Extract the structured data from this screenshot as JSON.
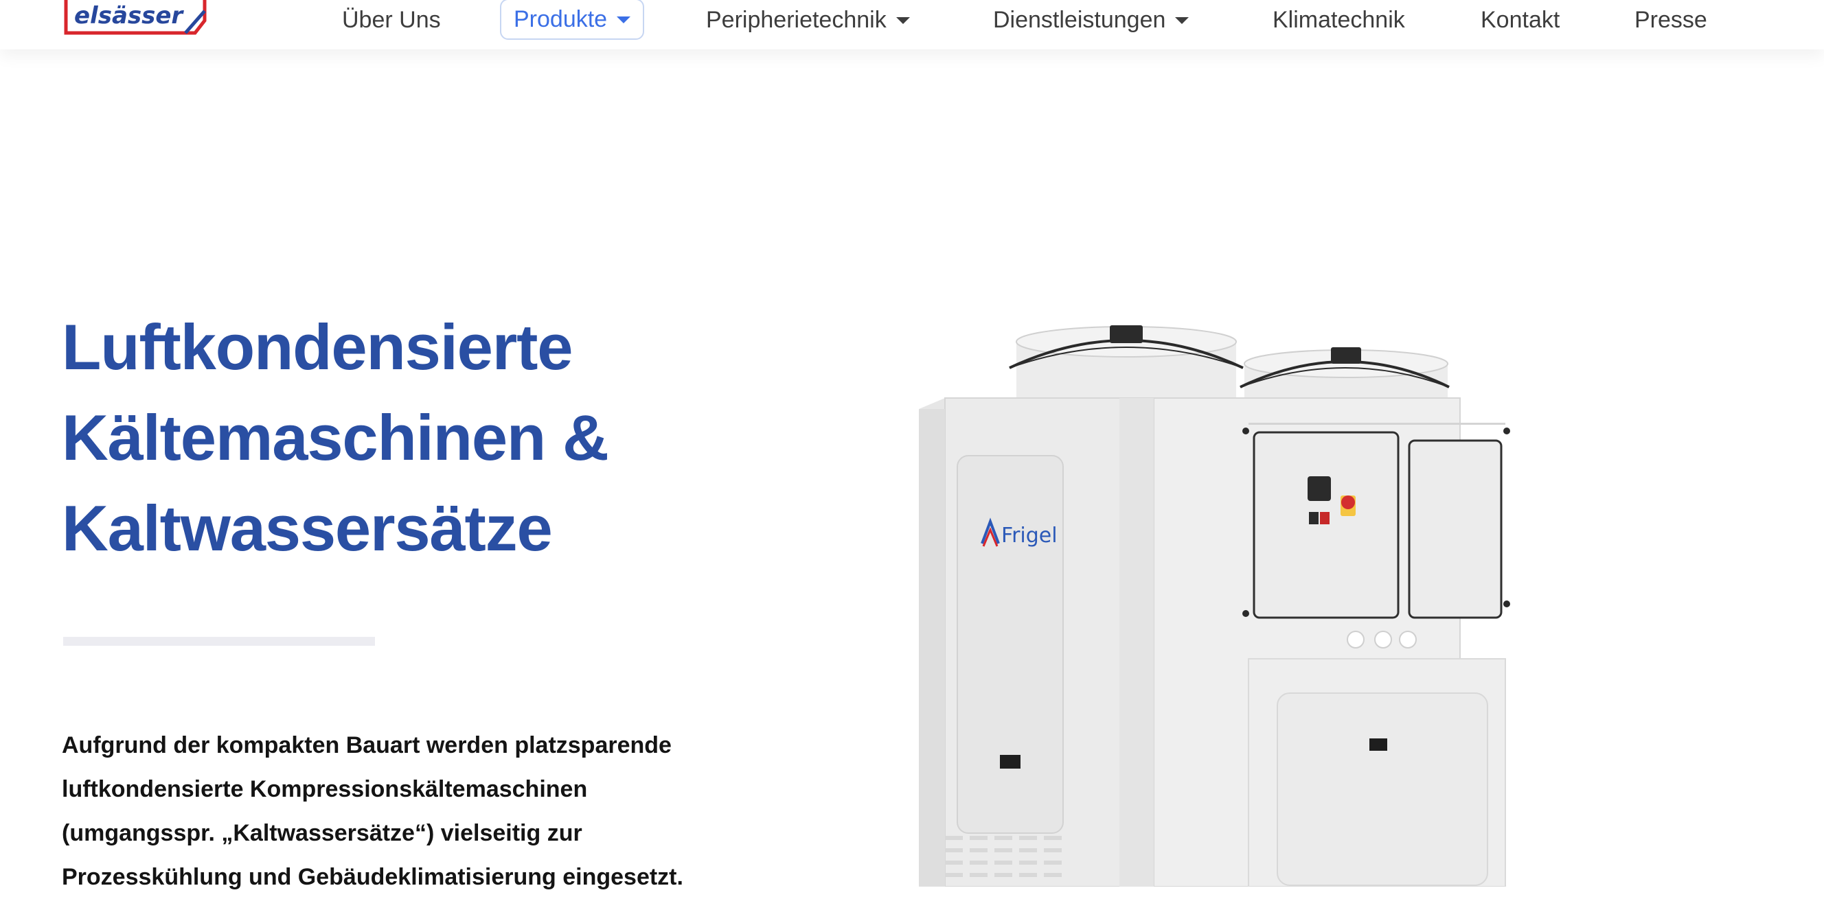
{
  "brand": {
    "logo_text": "elsässer"
  },
  "nav": {
    "items": [
      {
        "label": "Über Uns",
        "dropdown": false,
        "active": false
      },
      {
        "label": "Produkte",
        "dropdown": true,
        "active": true
      },
      {
        "label": "Peripherietechnik",
        "dropdown": true,
        "active": false
      },
      {
        "label": "Dienstleistungen",
        "dropdown": true,
        "active": false
      },
      {
        "label": "Klimatechnik",
        "dropdown": false,
        "active": false
      },
      {
        "label": "Kontakt",
        "dropdown": false,
        "active": false
      },
      {
        "label": "Presse",
        "dropdown": false,
        "active": false
      }
    ]
  },
  "hero": {
    "title_lines": [
      "Luftkondensierte",
      "Kältemaschinen &",
      "Kaltwassersätze"
    ],
    "paragraph_lines": [
      "Aufgrund der kompakten Bauart werden platzsparende",
      "luftkondensierte Kompressionskältemaschinen",
      "(umgangsspr. „Kaltwassersätze“) vielseitig zur",
      "Prozesskühlung und Gebäudeklimatisierung eingesetzt."
    ]
  },
  "product": {
    "brand_label": "Frigel"
  },
  "colors": {
    "accent": "#3b6fe6",
    "title": "#2a4fa3",
    "text": "#141414",
    "nav_text": "#3d3d3d",
    "logo_red": "#d8262c",
    "logo_blue": "#27479c"
  }
}
